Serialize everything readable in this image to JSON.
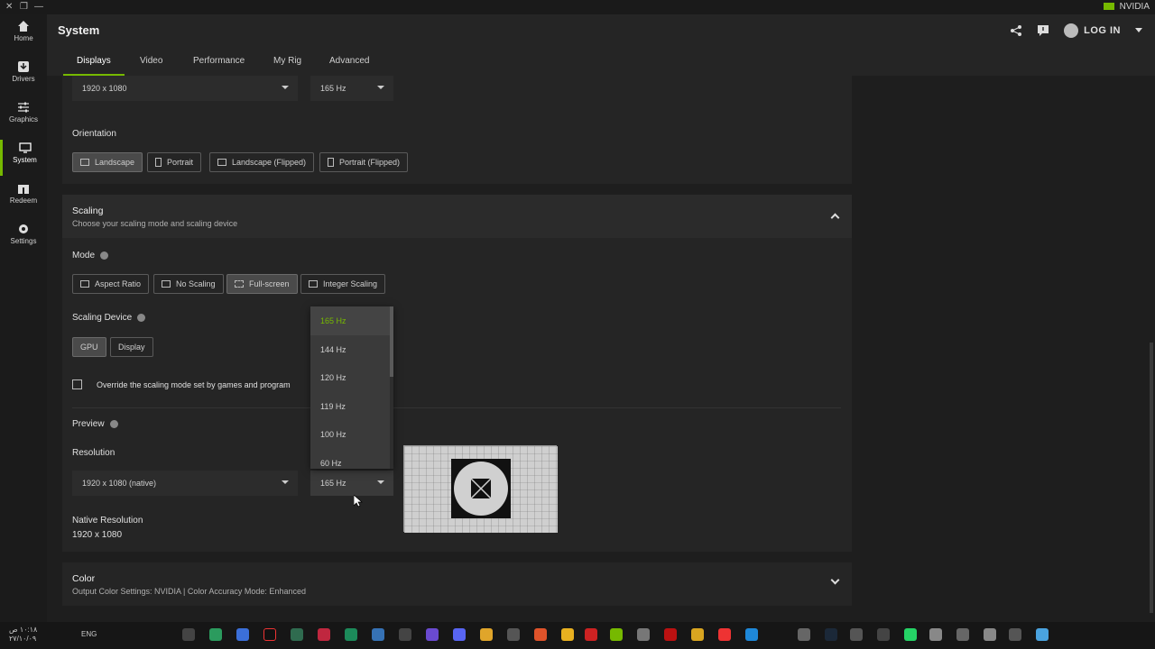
{
  "brand": "NVIDIA",
  "sidebar": {
    "items": [
      {
        "label": "Home",
        "icon": "home-icon"
      },
      {
        "label": "Drivers",
        "icon": "drivers-icon"
      },
      {
        "label": "Graphics",
        "icon": "sliders-icon"
      },
      {
        "label": "System",
        "icon": "monitor-icon",
        "active": true
      },
      {
        "label": "Redeem",
        "icon": "gift-icon"
      },
      {
        "label": "Settings",
        "icon": "gear-icon"
      }
    ]
  },
  "header": {
    "title": "System",
    "login": "LOG IN"
  },
  "tabs": [
    "Displays",
    "Video",
    "Performance",
    "My Rig",
    "Advanced"
  ],
  "display": {
    "resolution": "1920 x 1080",
    "refresh": "165 Hz",
    "orientation_label": "Orientation",
    "orientations": [
      "Landscape",
      "Portrait",
      "Landscape (Flipped)",
      "Portrait (Flipped)"
    ],
    "orientation_selected": "Landscape"
  },
  "scaling": {
    "title": "Scaling",
    "subtitle": "Choose your scaling mode and scaling device",
    "mode_label": "Mode",
    "modes": [
      "Aspect Ratio",
      "No Scaling",
      "Full-screen",
      "Integer Scaling"
    ],
    "mode_selected": "Full-screen",
    "device_label": "Scaling Device",
    "devices": [
      "GPU",
      "Display"
    ],
    "device_selected": "GPU",
    "override_label": "Override the scaling mode set by games and program",
    "preview_label": "Preview",
    "resolution_label": "Resolution",
    "resolution_value": "1920 x 1080 (native)",
    "refresh_value": "165 Hz",
    "refresh_options": [
      "165 Hz",
      "144 Hz",
      "120 Hz",
      "119 Hz",
      "100 Hz",
      "60 Hz"
    ],
    "native_label": "Native Resolution",
    "native_value": "1920 x 1080"
  },
  "color": {
    "title": "Color",
    "subtitle": "Output Color Settings: NVIDIA | Color Accuracy Mode: Enhanced"
  },
  "taskbar": {
    "lang": "ENG",
    "time": "١٠:١٨ ص",
    "date": "٢٧/١٠/٠٩"
  },
  "colors": {
    "accent": "#76b900",
    "panel": "#252525",
    "bg": "#1e1e1e"
  }
}
